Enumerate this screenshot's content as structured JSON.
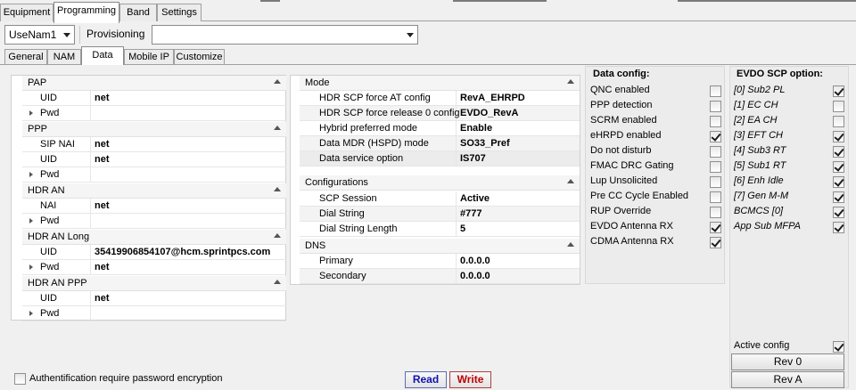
{
  "tabs": [
    "Equipment",
    "Programming",
    "Band",
    "Settings"
  ],
  "toolbar": {
    "nam_select": "UseNam1",
    "provisioning_label": "Provisioning",
    "provisioning_value": ""
  },
  "subtabs": [
    "General",
    "NAM",
    "Data",
    "Mobile IP",
    "Customize"
  ],
  "left": {
    "pap": {
      "title": "PAP",
      "uid_label": "UID",
      "uid": "net",
      "pwd_label": "Pwd",
      "pwd": ""
    },
    "ppp": {
      "title": "PPP",
      "sip_label": "SIP NAI",
      "sip": "net",
      "uid_label": "UID",
      "uid": "net",
      "pwd_label": "Pwd",
      "pwd": ""
    },
    "hdr_an": {
      "title": "HDR AN",
      "nai_label": "NAI",
      "nai": "net",
      "pwd_label": "Pwd",
      "pwd": ""
    },
    "hdr_an_long": {
      "title": "HDR AN Long",
      "uid_label": "UID",
      "uid": "35419906854107@hcm.sprintpcs.com",
      "pwd_label": "Pwd",
      "pwd": "net"
    },
    "hdr_an_ppp": {
      "title": "HDR AN PPP",
      "uid_label": "UID",
      "uid": "net",
      "pwd_label": "Pwd",
      "pwd": ""
    }
  },
  "middle": {
    "mode": {
      "title": "Mode",
      "rows": [
        {
          "label": "HDR SCP force AT config",
          "value": "RevA_EHRPD"
        },
        {
          "label": "HDR SCP force release 0 config",
          "value": "EVDO_RevA"
        },
        {
          "label": "Hybrid preferred mode",
          "value": "Enable"
        },
        {
          "label": "Data MDR (HSPD) mode",
          "value": "SO33_Pref"
        },
        {
          "label": "Data service option",
          "value": "IS707"
        }
      ]
    },
    "configurations": {
      "title": "Configurations",
      "rows": [
        {
          "label": "SCP Session",
          "value": "Active"
        },
        {
          "label": "Dial String",
          "value": "#777"
        },
        {
          "label": "Dial String Length",
          "value": "5"
        }
      ]
    },
    "dns": {
      "title": "DNS",
      "rows": [
        {
          "label": "Primary",
          "value": "0.0.0.0"
        },
        {
          "label": "Secondary",
          "value": "0.0.0.0"
        }
      ]
    }
  },
  "data_config": {
    "title": "Data config:",
    "items": [
      {
        "label": "QNC enabled",
        "checked": false
      },
      {
        "label": "PPP detection",
        "checked": false
      },
      {
        "label": "SCRM enabled",
        "checked": false
      },
      {
        "label": "eHRPD enabled",
        "checked": true
      },
      {
        "label": "Do not disturb",
        "checked": false
      },
      {
        "label": "FMAC DRC Gating",
        "checked": false
      },
      {
        "label": "Lup Unsolicited",
        "checked": false
      },
      {
        "label": "Pre CC Cycle Enabled",
        "checked": false
      },
      {
        "label": "RUP Override",
        "checked": false
      },
      {
        "label": "EVDO Antenna RX",
        "checked": true
      },
      {
        "label": "CDMA Antenna RX",
        "checked": true
      }
    ]
  },
  "evdo": {
    "title": "EVDO SCP option:",
    "items": [
      {
        "label": "[0] Sub2 PL",
        "checked": true
      },
      {
        "label": "[1] EC CH",
        "checked": false
      },
      {
        "label": "[2] EA CH",
        "checked": false
      },
      {
        "label": "[3] EFT CH",
        "checked": true
      },
      {
        "label": "[4] Sub3 RT",
        "checked": true
      },
      {
        "label": "[5] Sub1 RT",
        "checked": true
      },
      {
        "label": "[6] Enh Idle",
        "checked": true
      },
      {
        "label": "[7] Gen M-M",
        "checked": true
      },
      {
        "label": "BCMCS [0]",
        "checked": true
      },
      {
        "label": "App Sub MFPA",
        "checked": true
      }
    ],
    "active_config_label": "Active config",
    "active_config_checked": true,
    "rev0": "Rev 0",
    "reva": "Rev A"
  },
  "footer": {
    "auth_label": "Authentification require password encryption",
    "auth_checked": false,
    "read": "Read",
    "write": "Write"
  },
  "colors": {
    "read": "#1010b0",
    "write": "#c00000",
    "active_tab": "#ffffff"
  }
}
